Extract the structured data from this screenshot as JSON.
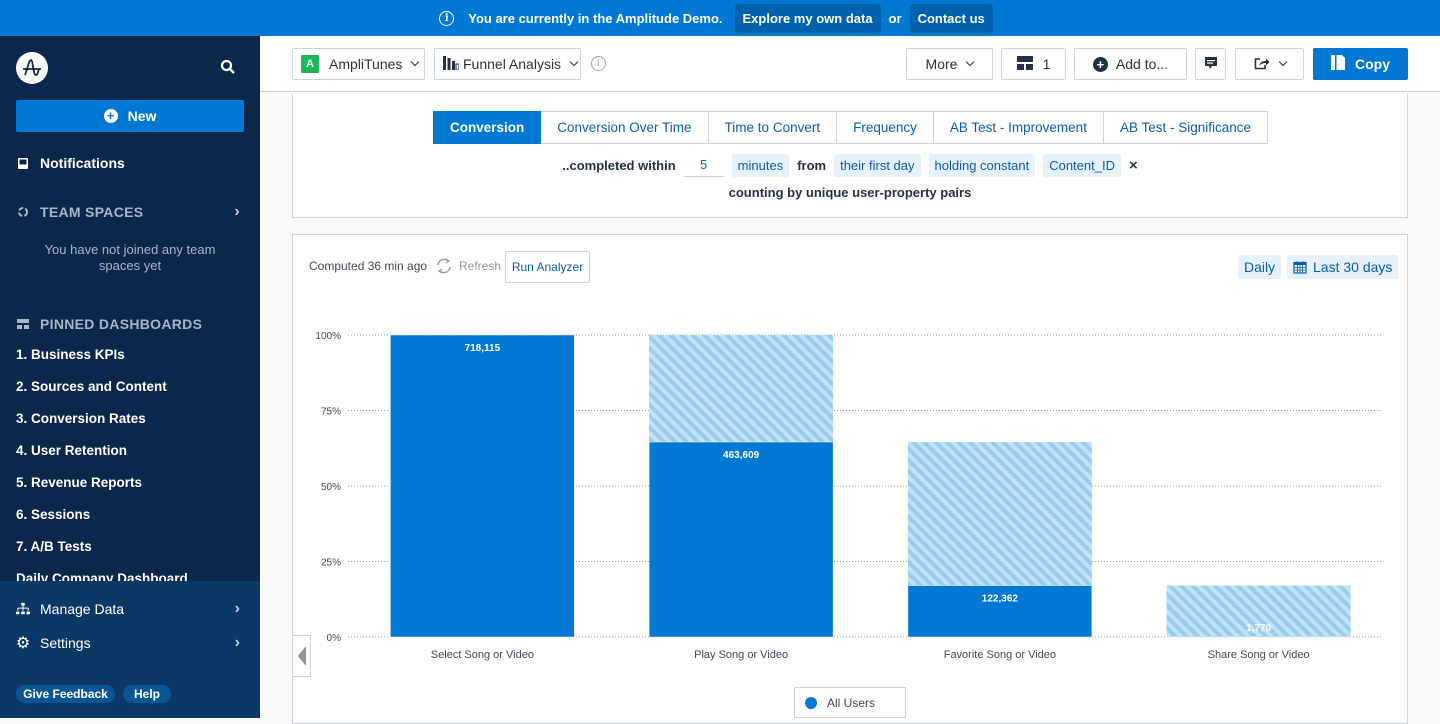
{
  "banner": {
    "message": "You are currently in the Amplitude Demo.",
    "explore_label": "Explore my own data",
    "or_text": "or",
    "contact_label": "Contact us"
  },
  "sidebar": {
    "new_label": "New",
    "notifications_label": "Notifications",
    "team_spaces_label": "TEAM SPACES",
    "team_spaces_note": "You have not joined any team spaces yet",
    "pinned_label": "PINNED DASHBOARDS",
    "pinned_items": [
      "1. Business KPIs",
      "2. Sources and Content",
      "3. Conversion Rates",
      "4. User Retention",
      "5. Revenue Reports",
      "6. Sessions",
      "7. A/B Tests",
      "Daily Company Dashboard"
    ],
    "manage_data_label": "Manage Data",
    "settings_label": "Settings",
    "feedback_label": "Give Feedback",
    "help_label": "Help"
  },
  "toolbar": {
    "project_badge": "A",
    "project_name": "AmpliTunes",
    "chart_type": "Funnel Analysis",
    "more_label": "More",
    "dashboard_count": "1",
    "add_to_label": "Add to...",
    "copy_label": "Copy"
  },
  "tabs": [
    {
      "label": "Conversion",
      "active": true
    },
    {
      "label": "Conversion Over Time",
      "active": false
    },
    {
      "label": "Time to Convert",
      "active": false
    },
    {
      "label": "Frequency",
      "active": false
    },
    {
      "label": "AB Test - Improvement",
      "active": false
    },
    {
      "label": "AB Test - Significance",
      "active": false
    }
  ],
  "conditions": {
    "completed_within": "..completed within",
    "window_value": "5",
    "window_unit": "minutes",
    "from_label": "from",
    "from_value": "their first day",
    "holding_label": "holding constant",
    "holding_property": "Content_ID",
    "remove_symbol": "×",
    "counting": "counting by unique user-property pairs"
  },
  "results": {
    "computed": "Computed 36 min ago",
    "refresh_label": "Refresh",
    "run_analyzer_label": "Run Analyzer",
    "interval": "Daily",
    "date_range": "Last 30 days",
    "legend": "All Users"
  },
  "colors": {
    "accent": "#0078d4",
    "sidebar_bg": "#0b274b",
    "dropoff_light": "#c4e2f7",
    "dropoff_stripe": "#95cdf0"
  },
  "chart_data": {
    "type": "bar",
    "title": "",
    "xlabel": "",
    "ylabel": "",
    "ylim": [
      0,
      100
    ],
    "yticks": [
      "0%",
      "25%",
      "50%",
      "75%",
      "100%"
    ],
    "grid": true,
    "legend_position": "bottom",
    "categories": [
      "Select Song or Video",
      "Play Song or Video",
      "Favorite Song or Video",
      "Share Song or Video"
    ],
    "series": [
      {
        "name": "All Users",
        "values": [
          718115,
          463609,
          122362,
          1770
        ],
        "labels": [
          "718,115",
          "463,609",
          "122,362",
          "1,770"
        ]
      }
    ],
    "converted_pct": [
      100,
      64.56,
      17.04,
      0.25
    ],
    "previous_step_pct": [
      100,
      100,
      64.56,
      17.04
    ]
  }
}
